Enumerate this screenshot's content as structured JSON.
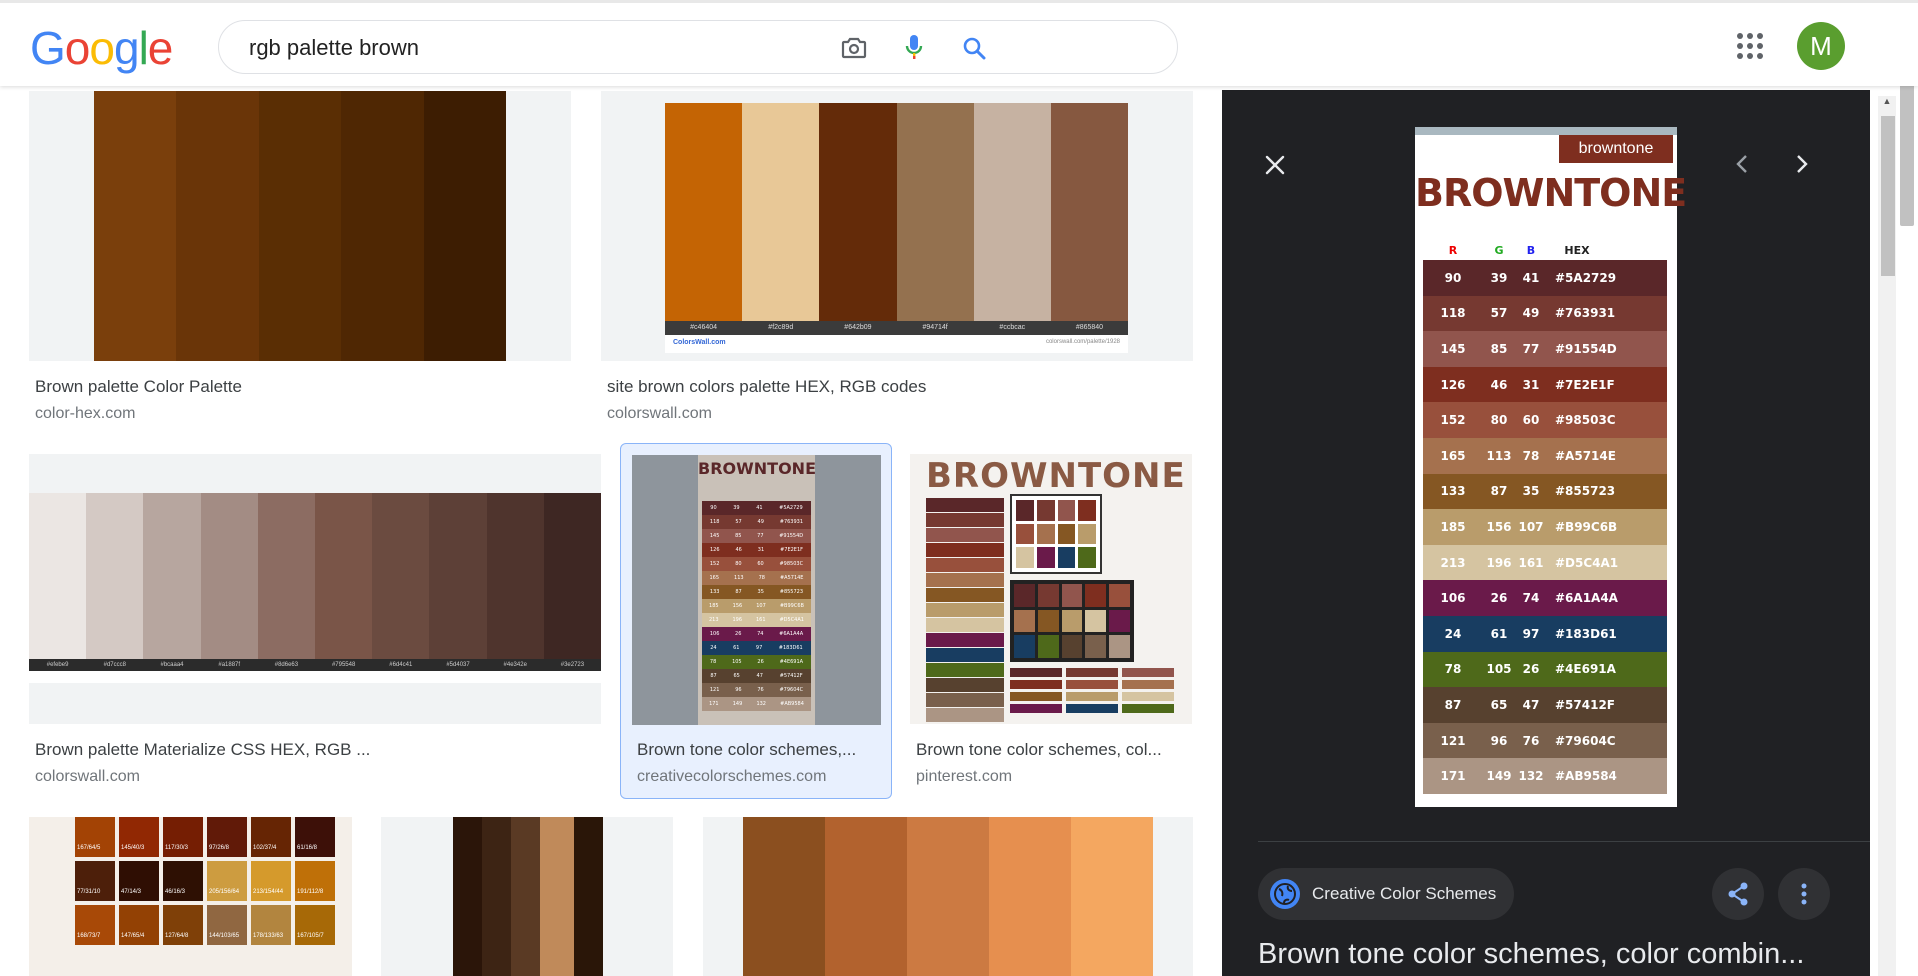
{
  "logo": {
    "letters": [
      "G",
      "o",
      "o",
      "g",
      "l",
      "e"
    ],
    "colors": [
      "#4285f4",
      "#ea4335",
      "#fbbc05",
      "#4285f4",
      "#34a853",
      "#ea4335"
    ]
  },
  "search": {
    "query": "rgb palette brown"
  },
  "account": {
    "initial": "M"
  },
  "results": [
    {
      "title": "Brown palette Color Palette",
      "source": "color-hex.com",
      "swatches": [
        "#7a3f0c",
        "#6a3508",
        "#5a2e04",
        "#4f2703",
        "#3d1d02"
      ]
    },
    {
      "title": "site brown colors palette HEX, RGB codes",
      "source": "colorswall.com",
      "swatches": [
        "#c46404",
        "#e8c897",
        "#642b09",
        "#94714f",
        "#c6b2a2",
        "#865840"
      ],
      "codes": [
        "#c46404",
        "#f2c89d",
        "#642b09",
        "#94714f",
        "#ccbcac",
        "#865840"
      ],
      "footer_left": "ColorsWall.com",
      "footer_right": "colorswall.com/palette/1928"
    },
    {
      "title": "Brown palette Materialize CSS HEX, RGB ...",
      "source": "colorswall.com",
      "swatches": [
        "#ebe6e3",
        "#d4c9c4",
        "#b7a69f",
        "#a38c84",
        "#8c6c62",
        "#7a5548",
        "#6b4b40",
        "#5d4037",
        "#4f342d",
        "#3e2723"
      ],
      "codes": [
        "#efebe9",
        "#d7ccc8",
        "#bcaaa4",
        "#a1887f",
        "#8d6e63",
        "#795548",
        "#6d4c41",
        "#5d4037",
        "#4e342e",
        "#3e2723"
      ]
    },
    {
      "title": "Brown tone color schemes,...",
      "source": "creativecolorschemes.com"
    },
    {
      "title": "Brown tone color schemes, col...",
      "source": "pinterest.com"
    }
  ],
  "bottom_row": {
    "grid_labels": [
      "167/64/5",
      "145/40/3",
      "117/30/3",
      "97/26/8",
      "102/37/4",
      "61/16/8",
      "77/31/10",
      "47/14/3",
      "46/16/3",
      "205/156/64",
      "213/154/44",
      "191/112/8",
      "168/73/7",
      "147/65/4",
      "127/64/8",
      "144/103/65",
      "178/133/63",
      "167/105/7"
    ],
    "grid_colors": [
      "#a34305",
      "#912803",
      "#751e03",
      "#611a08",
      "#662504",
      "#3d1008",
      "#4d1f0a",
      "#2f0e03",
      "#2e1003",
      "#cd9c40",
      "#d59a2c",
      "#bf7008",
      "#a84907",
      "#934104",
      "#7f4008",
      "#906741",
      "#b2853f",
      "#a76907"
    ],
    "strip_colors": [
      "#2b1509",
      "#3d2414",
      "#5a3a24",
      "#c08a5a",
      "#2a1608"
    ],
    "gradient_colors": [
      "#8b4f1f",
      "#b2622e",
      "#cc7a42",
      "#e68f4f",
      "#f4a760"
    ]
  },
  "panel": {
    "preview": {
      "badge": "browntone",
      "title": "BROWNTONE",
      "headers": [
        "R",
        "G",
        "B",
        "HEX"
      ],
      "rows": [
        {
          "r": "90",
          "g": "39",
          "b": "41",
          "hex": "#5A2729",
          "color": "#5a2729"
        },
        {
          "r": "118",
          "g": "57",
          "b": "49",
          "hex": "#763931",
          "color": "#763931"
        },
        {
          "r": "145",
          "g": "85",
          "b": "77",
          "hex": "#91554D",
          "color": "#91554d"
        },
        {
          "r": "126",
          "g": "46",
          "b": "31",
          "hex": "#7E2E1F",
          "color": "#7e2e1f"
        },
        {
          "r": "152",
          "g": "80",
          "b": "60",
          "hex": "#98503C",
          "color": "#98503c"
        },
        {
          "r": "165",
          "g": "113",
          "b": "78",
          "hex": "#A5714E",
          "color": "#a5714e"
        },
        {
          "r": "133",
          "g": "87",
          "b": "35",
          "hex": "#855723",
          "color": "#855723"
        },
        {
          "r": "185",
          "g": "156",
          "b": "107",
          "hex": "#B99C6B",
          "color": "#b99c6b"
        },
        {
          "r": "213",
          "g": "196",
          "b": "161",
          "hex": "#D5C4A1",
          "color": "#d5c4a1"
        },
        {
          "r": "106",
          "g": "26",
          "b": "74",
          "hex": "#6A1A4A",
          "color": "#6a1a4a"
        },
        {
          "r": "24",
          "g": "61",
          "b": "97",
          "hex": "#183D61",
          "color": "#183d61"
        },
        {
          "r": "78",
          "g": "105",
          "b": "26",
          "hex": "#4E691A",
          "color": "#4e691a"
        },
        {
          "r": "87",
          "g": "65",
          "b": "47",
          "hex": "#57412F",
          "color": "#57412f"
        },
        {
          "r": "121",
          "g": "96",
          "b": "76",
          "hex": "#79604C",
          "color": "#79604c"
        },
        {
          "r": "171",
          "g": "149",
          "b": "132",
          "hex": "#AB9584",
          "color": "#ab9584"
        }
      ]
    },
    "source_name": "Creative Color Schemes",
    "title": "Brown tone color schemes, color combin..."
  }
}
